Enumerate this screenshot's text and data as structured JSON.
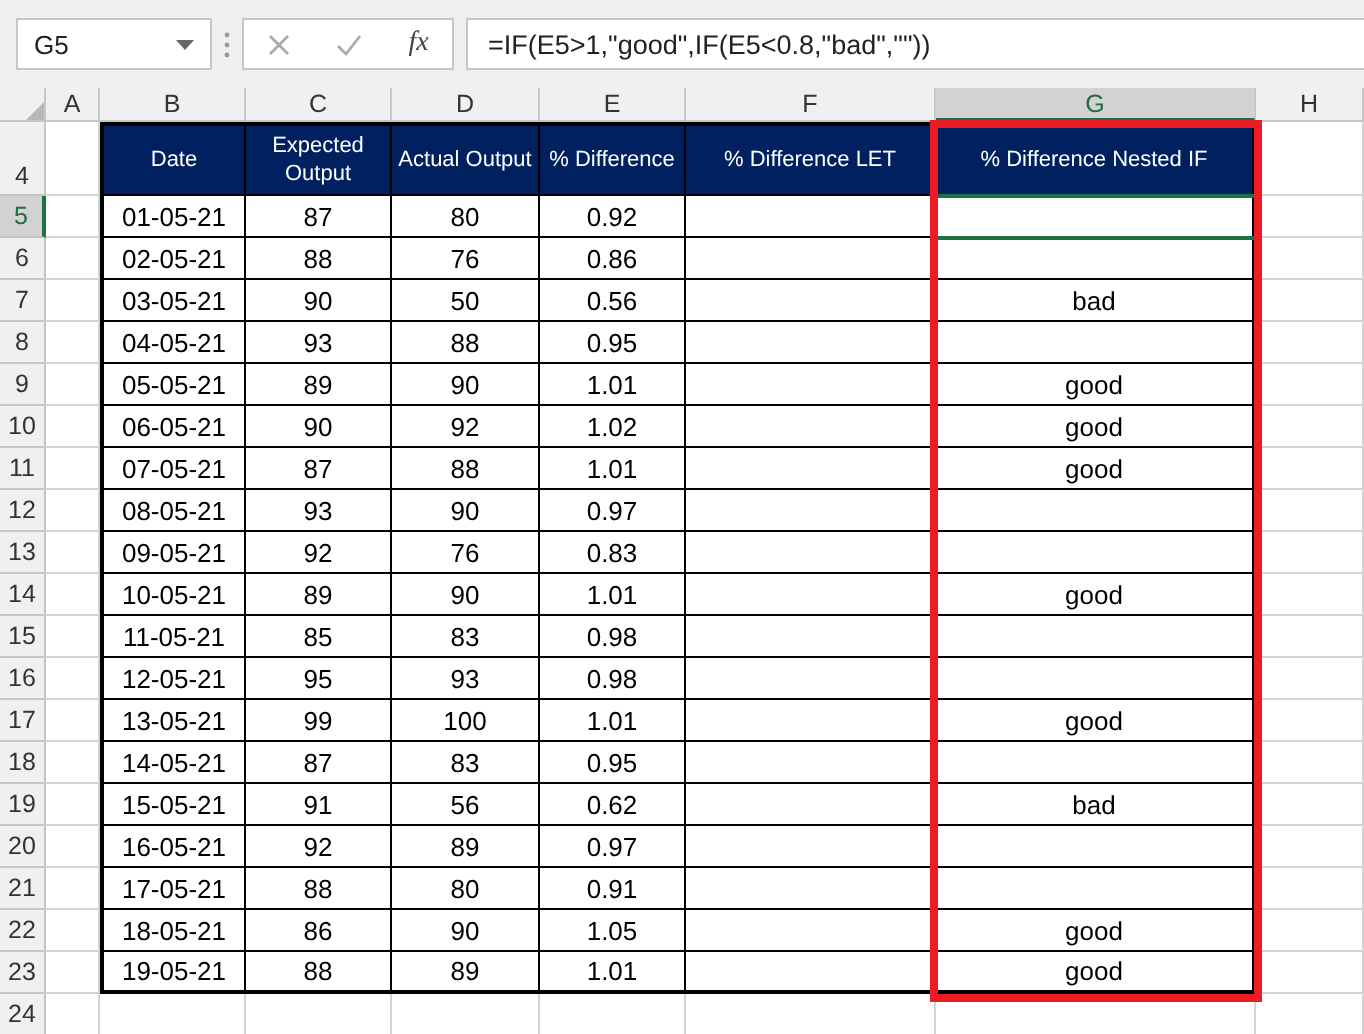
{
  "name_box": {
    "value": "G5"
  },
  "formula_bar": {
    "function_label": "fx",
    "formula": "=IF(E5>1,\"good\",IF(E5<0.8,\"bad\",\"\"))"
  },
  "columns": [
    {
      "label": "A",
      "selected": false,
      "highlighted": false
    },
    {
      "label": "B",
      "selected": false,
      "highlighted": false
    },
    {
      "label": "C",
      "selected": false,
      "highlighted": false
    },
    {
      "label": "D",
      "selected": false,
      "highlighted": false
    },
    {
      "label": "E",
      "selected": false,
      "highlighted": false
    },
    {
      "label": "F",
      "selected": false,
      "highlighted": false
    },
    {
      "label": "G",
      "selected": true,
      "highlighted": true
    },
    {
      "label": "H",
      "selected": false,
      "highlighted": false
    }
  ],
  "header_row": {
    "row": "4",
    "headers": [
      "Date",
      "Expected Output",
      "Actual Output",
      "% Difference",
      "% Difference LET",
      "% Difference Nested IF"
    ]
  },
  "rows": [
    {
      "row": "5",
      "selected": true,
      "date": "01-05-21",
      "expected": "87",
      "actual": "80",
      "diff": "0.92"
    },
    {
      "row": "6",
      "selected": false,
      "date": "02-05-21",
      "expected": "88",
      "actual": "76",
      "diff": "0.86"
    },
    {
      "row": "7",
      "selected": false,
      "date": "03-05-21",
      "expected": "90",
      "actual": "50",
      "diff": "0.56",
      "nested_if": "bad"
    },
    {
      "row": "8",
      "selected": false,
      "date": "04-05-21",
      "expected": "93",
      "actual": "88",
      "diff": "0.95"
    },
    {
      "row": "9",
      "selected": false,
      "date": "05-05-21",
      "expected": "89",
      "actual": "90",
      "diff": "1.01",
      "nested_if": "good"
    },
    {
      "row": "10",
      "selected": false,
      "date": "06-05-21",
      "expected": "90",
      "actual": "92",
      "diff": "1.02",
      "nested_if": "good"
    },
    {
      "row": "11",
      "selected": false,
      "date": "07-05-21",
      "expected": "87",
      "actual": "88",
      "diff": "1.01",
      "nested_if": "good"
    },
    {
      "row": "12",
      "selected": false,
      "date": "08-05-21",
      "expected": "93",
      "actual": "90",
      "diff": "0.97"
    },
    {
      "row": "13",
      "selected": false,
      "date": "09-05-21",
      "expected": "92",
      "actual": "76",
      "diff": "0.83"
    },
    {
      "row": "14",
      "selected": false,
      "date": "10-05-21",
      "expected": "89",
      "actual": "90",
      "diff": "1.01",
      "nested_if": "good"
    },
    {
      "row": "15",
      "selected": false,
      "date": "11-05-21",
      "expected": "85",
      "actual": "83",
      "diff": "0.98"
    },
    {
      "row": "16",
      "selected": false,
      "date": "12-05-21",
      "expected": "95",
      "actual": "93",
      "diff": "0.98"
    },
    {
      "row": "17",
      "selected": false,
      "date": "13-05-21",
      "expected": "99",
      "actual": "100",
      "diff": "1.01",
      "nested_if": "good"
    },
    {
      "row": "18",
      "selected": false,
      "date": "14-05-21",
      "expected": "87",
      "actual": "83",
      "diff": "0.95"
    },
    {
      "row": "19",
      "selected": false,
      "date": "15-05-21",
      "expected": "91",
      "actual": "56",
      "diff": "0.62",
      "nested_if": "bad"
    },
    {
      "row": "20",
      "selected": false,
      "date": "16-05-21",
      "expected": "92",
      "actual": "89",
      "diff": "0.97"
    },
    {
      "row": "21",
      "selected": false,
      "date": "17-05-21",
      "expected": "88",
      "actual": "80",
      "diff": "0.91"
    },
    {
      "row": "22",
      "selected": false,
      "date": "18-05-21",
      "expected": "86",
      "actual": "90",
      "diff": "1.05",
      "nested_if": "good"
    },
    {
      "row": "23",
      "selected": false,
      "date": "19-05-21",
      "expected": "88",
      "actual": "89",
      "diff": "1.01",
      "nested_if": "good"
    }
  ],
  "trailing_rows": [
    "24"
  ]
}
